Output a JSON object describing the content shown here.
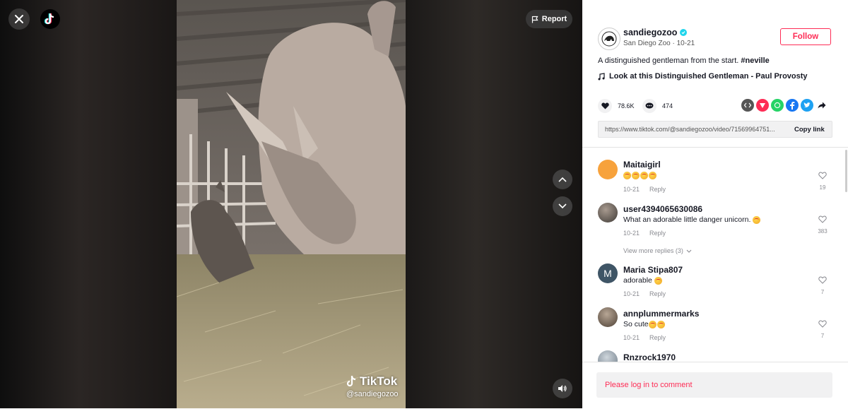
{
  "player": {
    "report_label": "Report",
    "watermark_brand": "TikTok",
    "watermark_handle": "@sandiegozoo"
  },
  "post": {
    "username": "sandiegozoo",
    "subinfo": "San Diego Zoo · 10-21",
    "follow_label": "Follow",
    "description_text": "A distinguished gentleman from the start. ",
    "description_tag": "#neville",
    "music": "Look at this Distinguished Gentleman - Paul Provosty",
    "likes": "78.6K",
    "comments_count": "474",
    "link": "https://www.tiktok.com/@sandiegozoo/video/71569964751...",
    "copy_link_label": "Copy link"
  },
  "comments": [
    {
      "name": "Maitaigirl",
      "text": "",
      "emoji_count": 4,
      "date": "10-21",
      "reply": "Reply",
      "likes": "19",
      "avatar_color": "#f7a23c"
    },
    {
      "name": "user4394065630086",
      "text": "What an adorable little danger unicorn.",
      "emoji_count": 1,
      "date": "10-21",
      "reply": "Reply",
      "likes": "383",
      "avatar_color": "#6b6b6b"
    },
    {
      "name": "Maria Stipa807",
      "text": "adorable",
      "emoji_count": 1,
      "date": "10-21",
      "reply": "Reply",
      "likes": "7",
      "avatar_color": "#3f5566",
      "initial": "M"
    },
    {
      "name": "annplummermarks",
      "text": "So cute",
      "emoji_count": 2,
      "date": "10-21",
      "reply": "Reply",
      "likes": "7",
      "avatar_color": "#7a6a5a"
    },
    {
      "name": "Rnzrock1970",
      "text": "",
      "avatar_color": "#9aa6b0"
    }
  ],
  "more_replies": "View more replies (3)",
  "login_prompt": "Please log in to comment",
  "colors": {
    "accent": "#fe2c55",
    "text": "#161823",
    "muted": "#8a8b91"
  }
}
